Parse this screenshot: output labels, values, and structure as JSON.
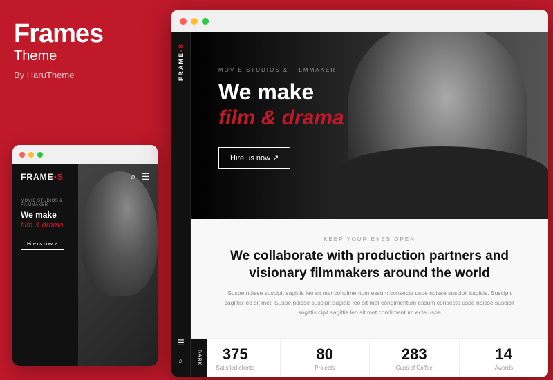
{
  "left_panel": {
    "brand": "Frames",
    "sub": "Theme",
    "author": "By HaruTheme"
  },
  "mobile": {
    "titlebar_dots": [
      "red",
      "yellow",
      "green"
    ],
    "logo": "FRAME",
    "logo_dot": "•S",
    "tag": "MOVIE STUDIOS & FILMMAKER",
    "heading_line1": "We make",
    "heading_italic": "film & drama",
    "cta": "Hire us now ↗"
  },
  "browser": {
    "titlebar_dots": [
      "red",
      "yellow",
      "green"
    ],
    "sidebar_logo": "FRAME•S",
    "hero": {
      "tag": "MOVIE STUDIOS & FILMMAKER",
      "heading_line1": "We make",
      "heading_italic": "film & drama",
      "cta": "Hire us now ↗"
    },
    "below": {
      "eyebrow": "KEEP YOUR EYES OPEN",
      "title": "We collaborate with production partners and visionary filmmakers around the world",
      "body": "Suspe ndisse suscipit sagittis leo sit met condimentum essum consecte uspe ndisse suscipit sagittis. Suscipit sagittis leo sit met. Suspe ndisse suscipit sagittis leo sit met condimentum essum consecte uspe ndisse suscipit sagittis cipit sagittis leo sit met condimentum ecte uspe"
    },
    "stats": [
      {
        "number": "375",
        "label": "Satisfied clients"
      },
      {
        "number": "80",
        "label": "Projects"
      },
      {
        "number": "283",
        "label": "Cups of Coffee"
      },
      {
        "number": "14",
        "label": "Awards"
      }
    ],
    "dark_tab": "Dark"
  },
  "colors": {
    "red": "#c0192a",
    "dark": "#111111",
    "light_bg": "#f8f8f8"
  }
}
